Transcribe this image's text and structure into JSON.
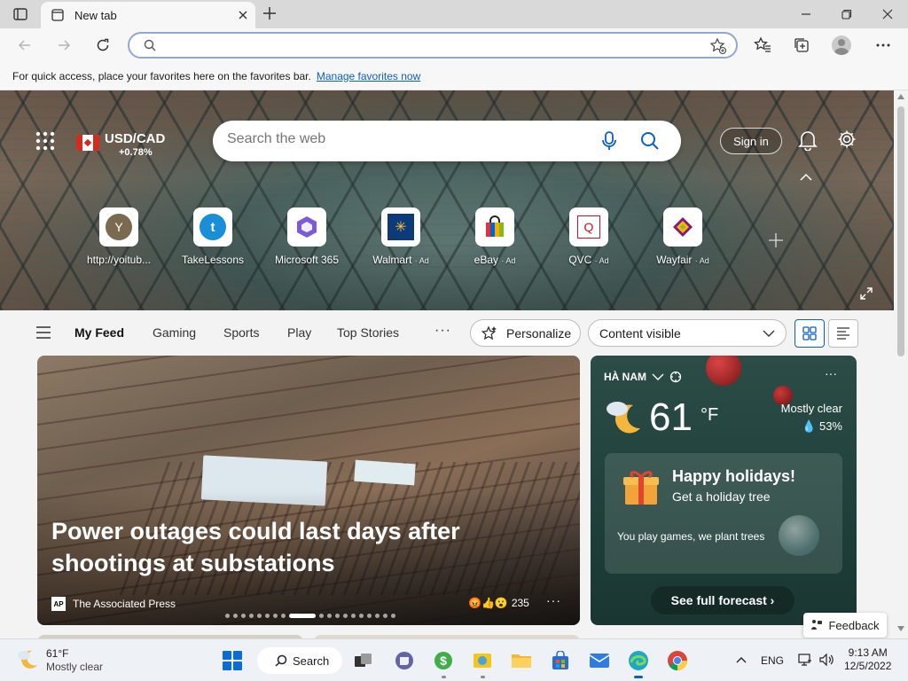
{
  "browser": {
    "tab_title": "New tab",
    "address_placeholder": "",
    "favbar_text": "For quick access, place your favorites here on the favorites bar.",
    "favbar_link": "Manage favorites now"
  },
  "hero": {
    "currency_pair": "USD/CAD",
    "currency_change": "+0.78%",
    "search_placeholder": "Search the web",
    "signin_label": "Sign in",
    "tiles": [
      {
        "name": "http://yoitub...",
        "ad": "",
        "glyph": "Y",
        "color": "#7a6a4f"
      },
      {
        "name": "TakeLessons",
        "ad": "",
        "glyph": "t",
        "color": "#1a8fd8"
      },
      {
        "name": "Microsoft 365",
        "ad": "",
        "glyph": "◆",
        "color": "#7b5cd6"
      },
      {
        "name": "Walmart",
        "ad": "· Ad",
        "glyph": "✳",
        "color": "#ffc220"
      },
      {
        "name": "eBay",
        "ad": "· Ad",
        "glyph": "▮",
        "color": "#e53238"
      },
      {
        "name": "QVC",
        "ad": "· Ad",
        "glyph": "Q",
        "color": "#c8102e"
      },
      {
        "name": "Wayfair",
        "ad": "· Ad",
        "glyph": "✿",
        "color": "#7f187f"
      }
    ]
  },
  "feed": {
    "tabs": [
      "My Feed",
      "Gaming",
      "Sports",
      "Play",
      "Top Stories"
    ],
    "more": "···",
    "personalize_label": "Personalize",
    "content_select": "Content visible"
  },
  "headline": {
    "title": "Power outages could last days after shootings at substations",
    "source": "The Associated Press",
    "source_logo": "AP",
    "reactions_count": "235",
    "reaction_emojis": "😡👍😮",
    "more": "···"
  },
  "weather": {
    "location": "HÀ NAM",
    "temperature": "61",
    "unit": "°F",
    "condition": "Mostly clear",
    "humidity": "💧 53%",
    "promo_title": "Happy holidays!",
    "promo_subtitle": "Get a holiday tree",
    "promo_text": "You play games, we plant trees",
    "forecast_button": "See full forecast ›",
    "more": "···"
  },
  "feedback_label": "Feedback",
  "taskbar": {
    "weather_temp": "61°F",
    "weather_cond": "Mostly clear",
    "search_label": "Search",
    "lang": "ENG",
    "time": "9:13 AM",
    "date": "12/5/2022"
  }
}
